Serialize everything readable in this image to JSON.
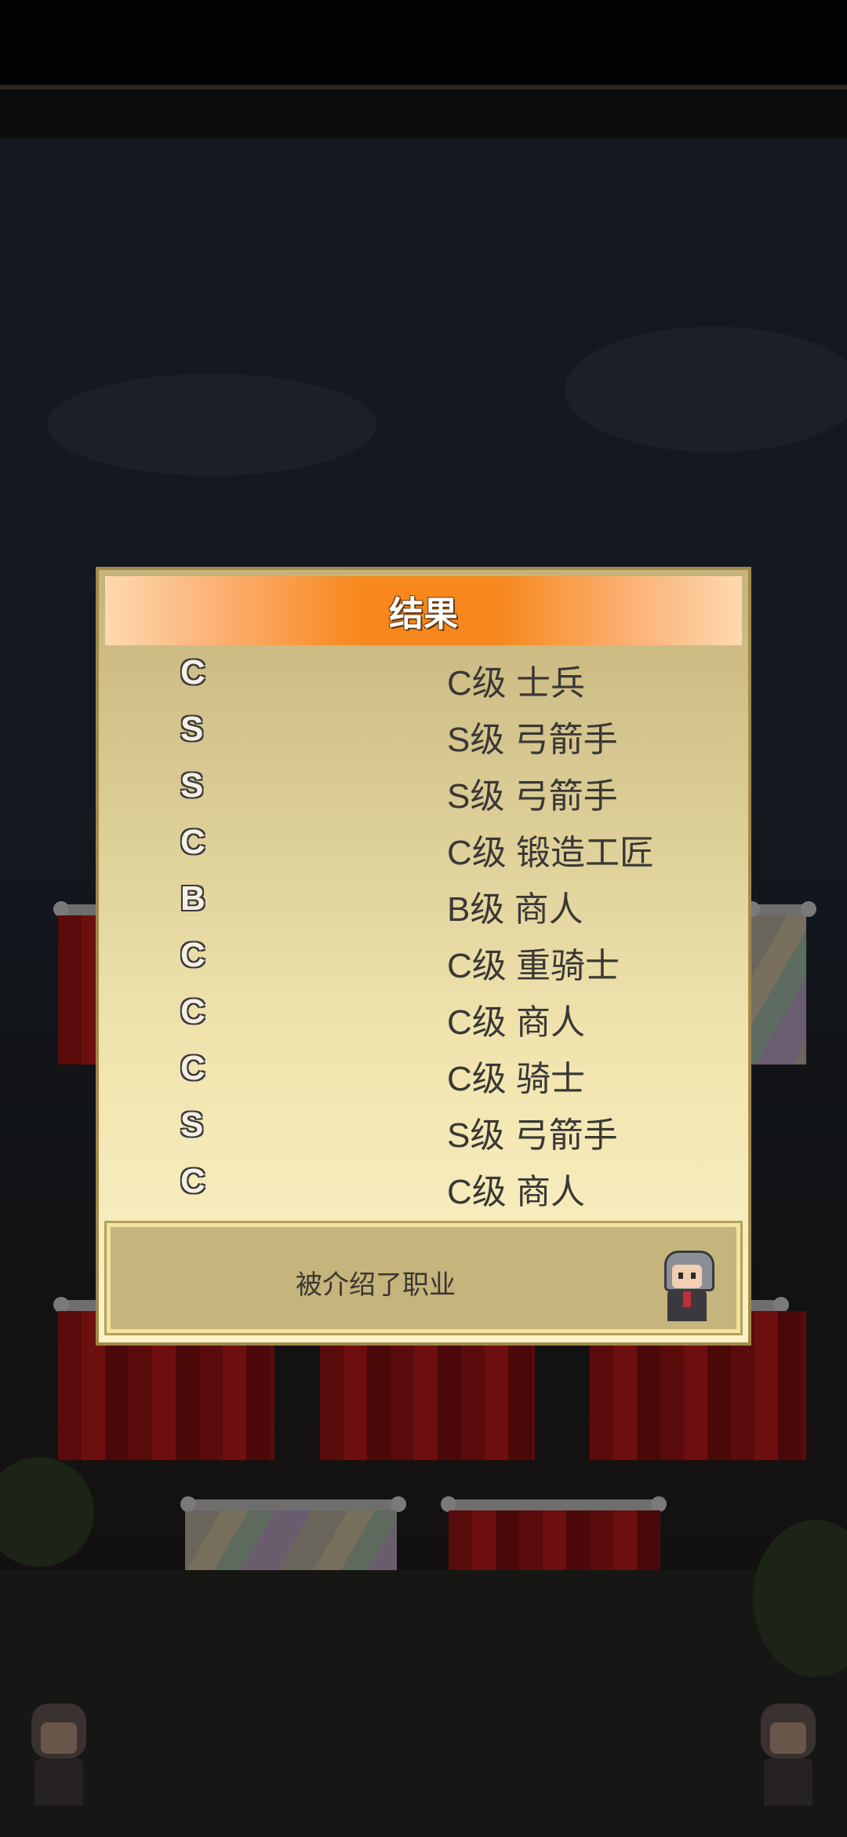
{
  "dialog": {
    "title": "结果",
    "results": [
      {
        "rank": "C",
        "job": "C级 士兵"
      },
      {
        "rank": "S",
        "job": "S级 弓箭手"
      },
      {
        "rank": "S",
        "job": "S级 弓箭手"
      },
      {
        "rank": "C",
        "job": "C级 锻造工匠"
      },
      {
        "rank": "B",
        "job": "B级 商人"
      },
      {
        "rank": "C",
        "job": "C级 重骑士"
      },
      {
        "rank": "C",
        "job": "C级 商人"
      },
      {
        "rank": "C",
        "job": "C级 骑士"
      },
      {
        "rank": "S",
        "job": "S级 弓箭手"
      },
      {
        "rank": "C",
        "job": "C级 商人"
      }
    ],
    "message": "被介绍了职业"
  }
}
